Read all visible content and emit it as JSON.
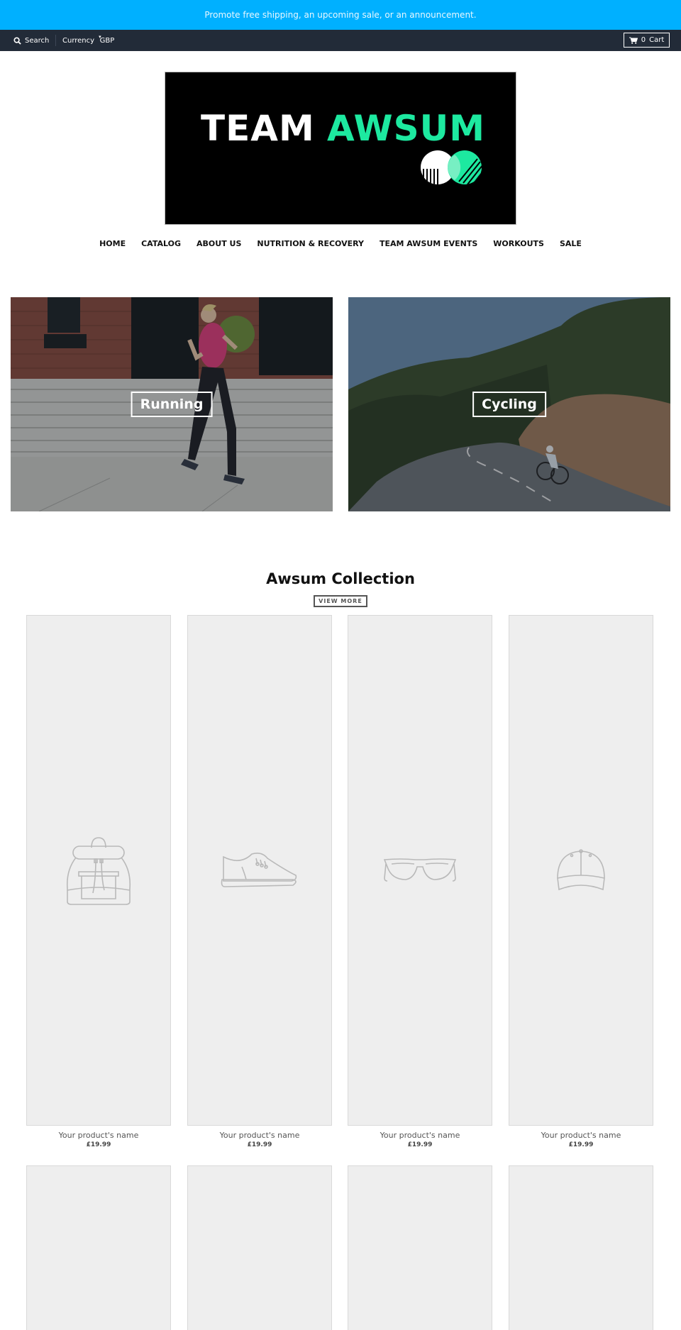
{
  "announcement": "Promote free shipping, an upcoming sale, or an announcement.",
  "topbar": {
    "search_label": "Search",
    "currency_label": "Currency",
    "currency_value": "GBP",
    "cart_count": "0",
    "cart_label": "Cart"
  },
  "logo": {
    "word1": "TEAM",
    "word2": "AWSUM",
    "bg_color": "#000000",
    "accent_color": "#1de9a0"
  },
  "nav": {
    "items": [
      {
        "label": "HOME"
      },
      {
        "label": "CATALOG"
      },
      {
        "label": "ABOUT US"
      },
      {
        "label": "NUTRITION & RECOVERY"
      },
      {
        "label": "TEAM AWSUM EVENTS"
      },
      {
        "label": "WORKOUTS"
      },
      {
        "label": "SALE"
      }
    ]
  },
  "heroes": [
    {
      "label": "Running"
    },
    {
      "label": "Cycling"
    }
  ],
  "collection": {
    "title": "Awsum Collection",
    "view_more": "VIEW MORE",
    "products": [
      {
        "name": "Your product's name",
        "price": "£19.99",
        "icon": "backpack-icon"
      },
      {
        "name": "Your product's name",
        "price": "£19.99",
        "icon": "sneaker-icon"
      },
      {
        "name": "Your product's name",
        "price": "£19.99",
        "icon": "sunglasses-icon"
      },
      {
        "name": "Your product's name",
        "price": "£19.99",
        "icon": "cap-icon"
      }
    ]
  },
  "colors": {
    "announcement_bg": "#00b0ff",
    "topbar_bg": "#222b38",
    "card_bg": "#eeeeee"
  }
}
